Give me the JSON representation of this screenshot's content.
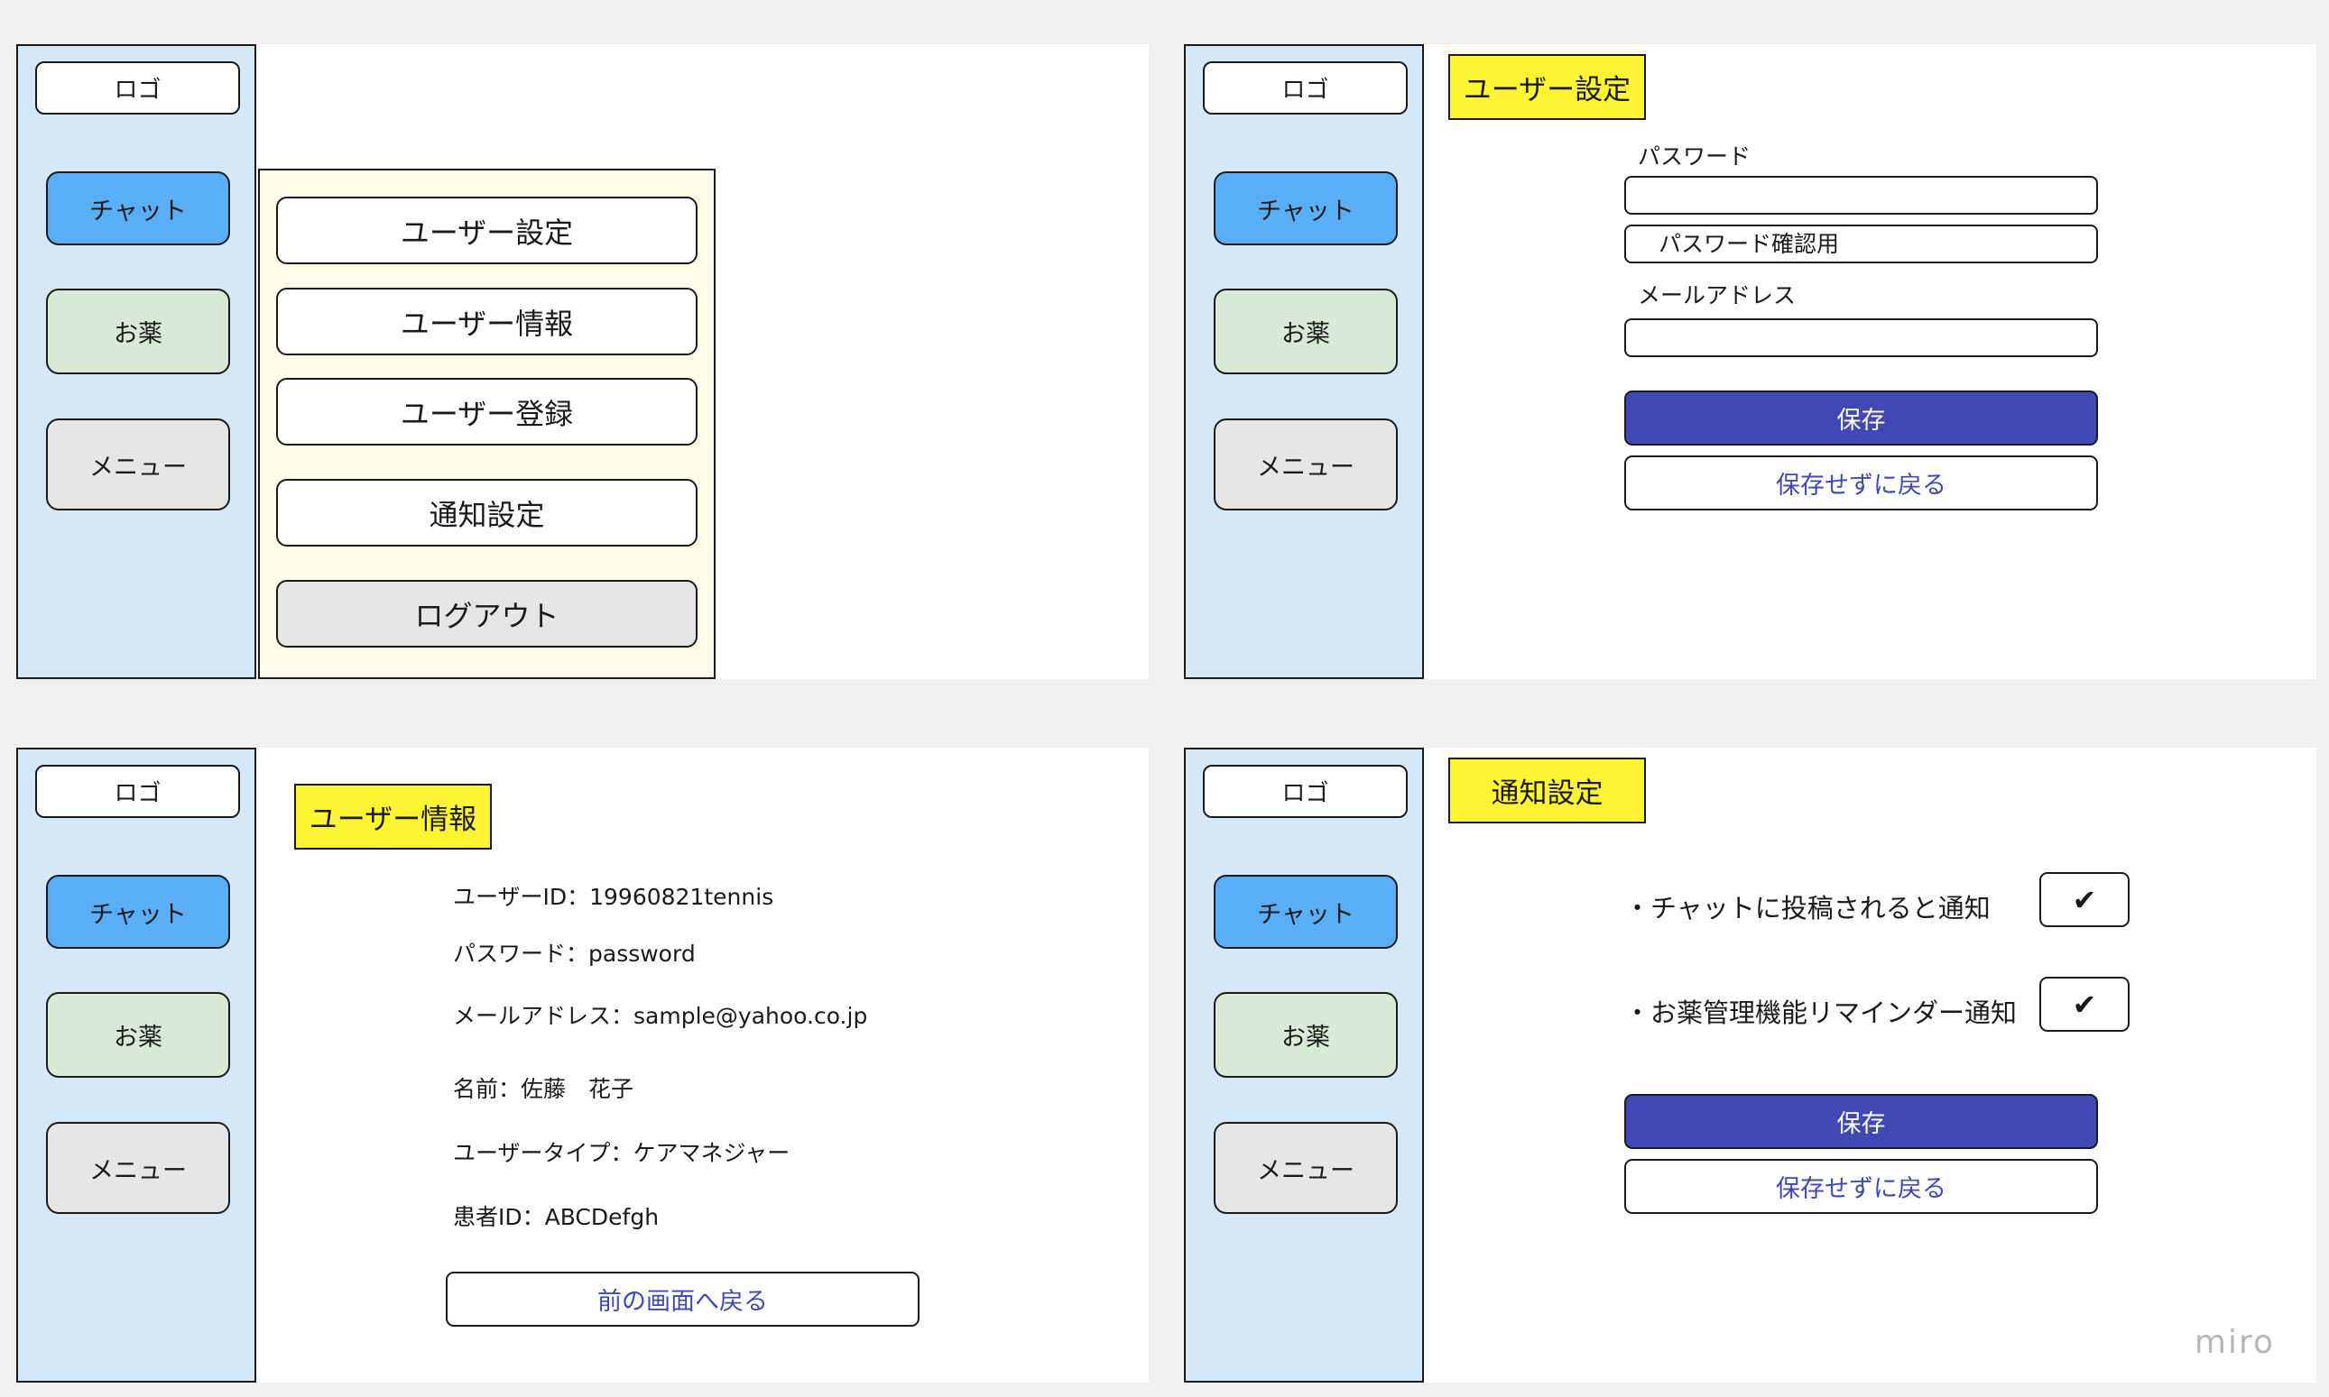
{
  "sidebar": {
    "logo": "ロゴ",
    "chat": "チャット",
    "medicine": "お薬",
    "menu": "メニュー"
  },
  "menu_screen": {
    "items": [
      "ユーザー設定",
      "ユーザー情報",
      "ユーザー登録",
      "通知設定",
      "ログアウト"
    ]
  },
  "user_settings": {
    "title": "ユーザー設定",
    "password_label": "パスワード",
    "password_value": "",
    "password_confirm_placeholder": "パスワード確認用",
    "email_label": "メールアドレス",
    "email_value": "",
    "save": "保存",
    "back": "保存せずに戻る"
  },
  "user_info": {
    "title": "ユーザー情報",
    "user_id": "ユーザーID：19960821tennis",
    "password": "パスワード：password",
    "email": "メールアドレス：sample@yahoo.co.jp",
    "name": "名前：佐藤　花子",
    "user_type": "ユーザータイプ：ケアマネジャー",
    "patient_id": "患者ID：ABCDefgh",
    "back": "前の画面へ戻る"
  },
  "notification_settings": {
    "title": "通知設定",
    "chat_notify": "・チャットに投稿されると通知",
    "chat_checked": "✔",
    "medicine_notify": "・お薬管理機能リマインダー通知",
    "medicine_checked": "✔",
    "save": "保存",
    "back": "保存せずに戻る"
  },
  "watermark": "miro",
  "colors": {
    "sidebar_bg": "#d5e8f8",
    "chat_button": "#5aaef5",
    "medicine_button": "#d6ead6",
    "menu_button": "#e6e6e6",
    "dropdown_bg": "#fefde9",
    "title_tag": "#fdf433",
    "save_button": "#3f48b4"
  }
}
